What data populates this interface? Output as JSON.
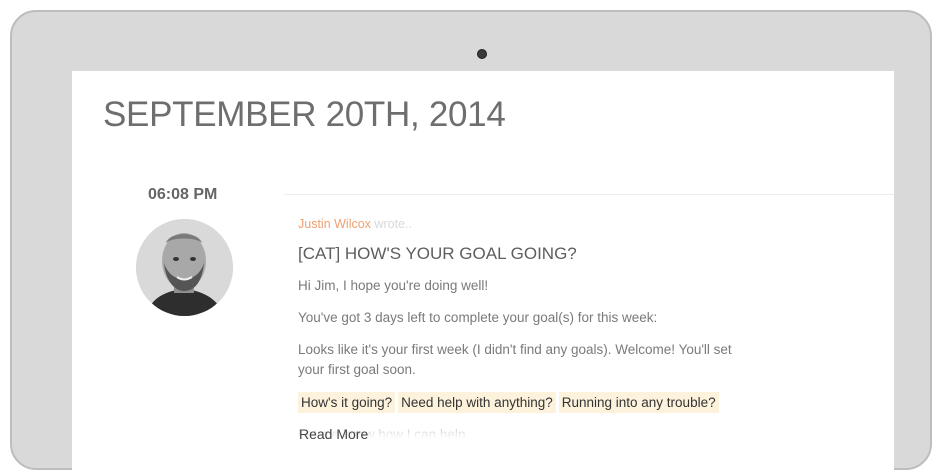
{
  "page": {
    "date_heading": "SEPTEMBER 20TH, 2014"
  },
  "entry": {
    "time": "06:08 PM",
    "author_name": "Justin Wilcox",
    "author_suffix": " wrote..",
    "title": "[CAT] HOW'S YOUR GOAL GOING?",
    "paragraphs": [
      "Hi Jim, I hope you're doing well!",
      "You've got 3 days left to complete your goal(s) for this week:",
      "Looks like it's your first week (I didn't find any goals). Welcome! You'll set your first goal soon."
    ],
    "highlights": [
      "How's it going?",
      "Need help with anything?",
      "Running into any trouble?"
    ],
    "cut_off_line": "Let me know how I can help",
    "read_more_label": "Read More"
  },
  "colors": {
    "laptop_frame": "#d9d9d9",
    "heading": "#6e6e6e",
    "author_accent": "#f0a070",
    "highlight_bg": "#fdf3dd"
  }
}
